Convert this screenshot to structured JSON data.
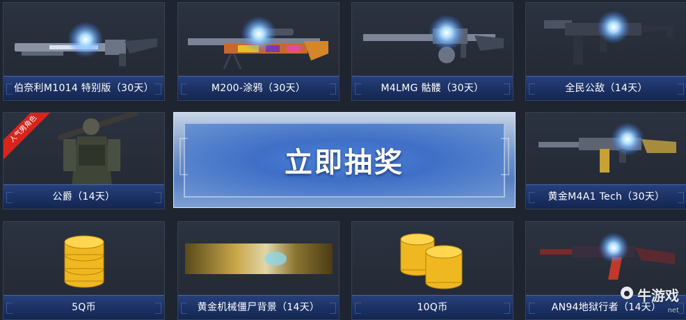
{
  "prizes": [
    {
      "name": "伯奈利M1014 特别版（30天）",
      "art": "shotgun-icon"
    },
    {
      "name": "M200-涂鸦（30天）",
      "art": "sniper-rifle-icon"
    },
    {
      "name": "M4LMG 骷髅（30天）",
      "art": "machine-gun-icon"
    },
    {
      "name": "全民公敌（14天）",
      "art": "smg-icon"
    },
    {
      "name": "公爵（14天）",
      "art": "character-icon",
      "badge": "人气男角色"
    },
    {
      "name": "黄金M4A1 Tech（30天）",
      "art": "assault-rifle-icon"
    },
    {
      "name": "5Q币",
      "art": "coin-stack-icon"
    },
    {
      "name": "黄金机械僵尸背景（14天）",
      "art": "background-banner-icon"
    },
    {
      "name": "10Q币",
      "art": "coin-stacks-icon"
    },
    {
      "name": "AN94地狱行者（14天）",
      "art": "rifle-icon"
    }
  ],
  "draw_button": {
    "label": "立即抽奖"
  },
  "watermark": {
    "brand": "牛游戏",
    "domain": "net"
  },
  "colors": {
    "label_blue": "#1b3163",
    "button_blue": "#4d82d8",
    "ribbon_red": "#d8241c",
    "coin_gold": "#f0b820"
  }
}
